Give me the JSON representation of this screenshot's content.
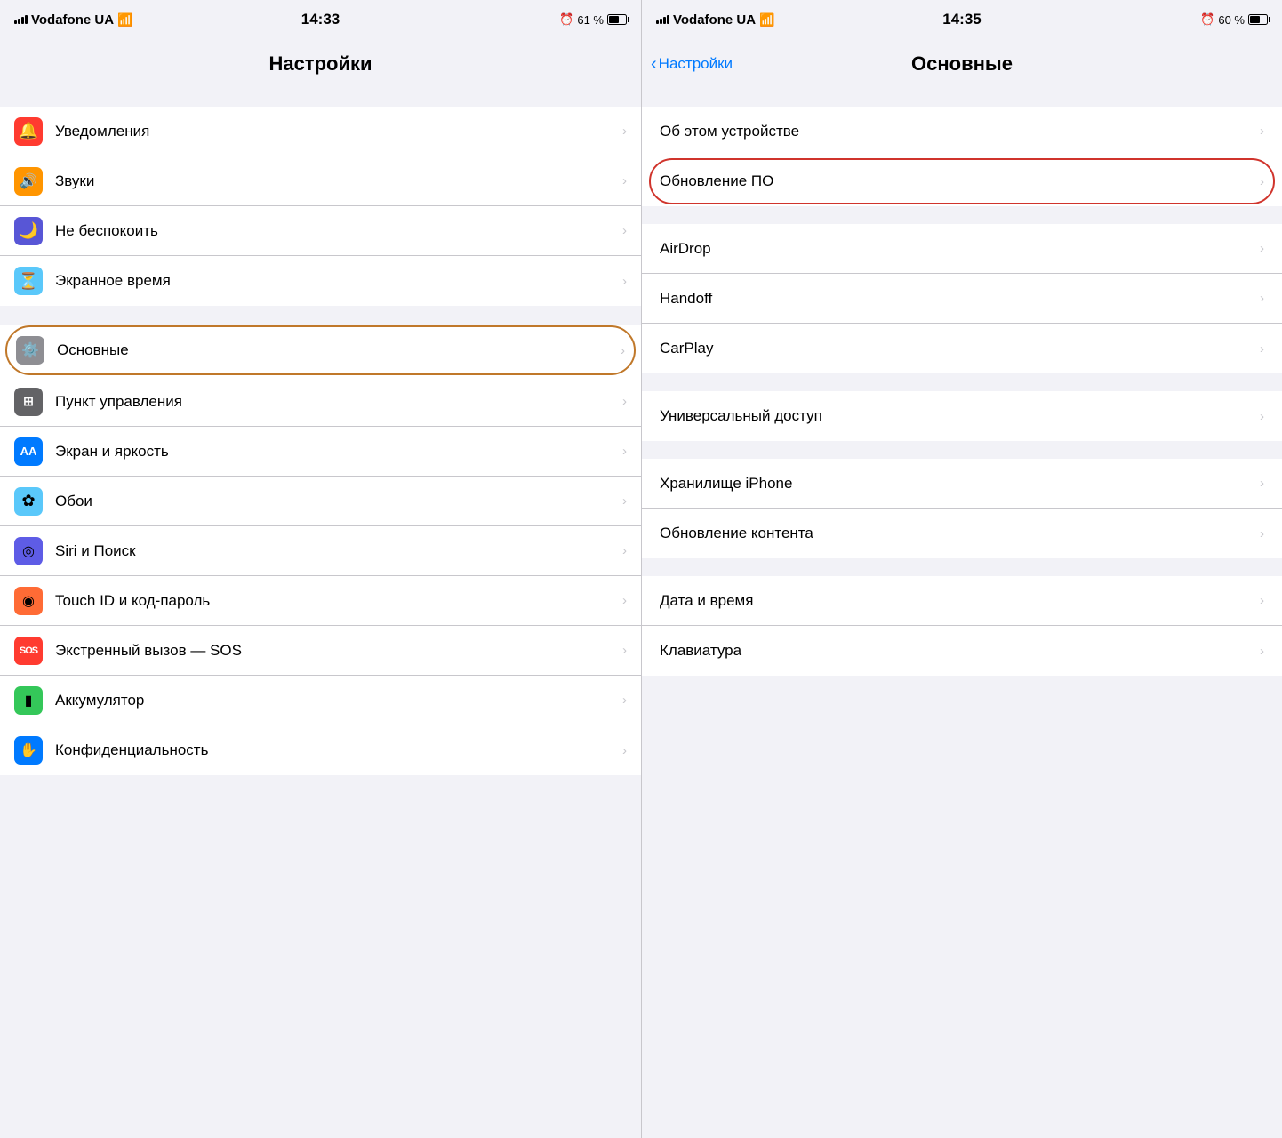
{
  "left_panel": {
    "status_bar": {
      "carrier": "Vodafone UA",
      "time": "14:33",
      "battery_percent": "61 %",
      "alarm": "⏰"
    },
    "nav": {
      "title": "Настройки"
    },
    "sections": [
      {
        "id": "notifications-group",
        "rows": [
          {
            "id": "notifications",
            "icon": "🔔",
            "icon_class": "icon-red",
            "label": "Уведомления"
          },
          {
            "id": "sounds",
            "icon": "🔊",
            "icon_class": "icon-orange",
            "label": "Звуки"
          },
          {
            "id": "do-not-disturb",
            "icon": "🌙",
            "icon_class": "icon-purple",
            "label": "Не беспокоить"
          },
          {
            "id": "screen-time",
            "icon": "⏳",
            "icon_class": "icon-indigo",
            "label": "Экранное время"
          }
        ]
      },
      {
        "id": "general-group",
        "rows": [
          {
            "id": "general",
            "icon": "⚙️",
            "icon_class": "icon-gray",
            "label": "Основные",
            "highlighted": true
          },
          {
            "id": "control-center",
            "icon": "⊞",
            "icon_class": "icon-gray2",
            "label": "Пункт управления"
          },
          {
            "id": "display",
            "icon": "AA",
            "icon_class": "icon-blue",
            "label": "Экран и яркость"
          },
          {
            "id": "wallpaper",
            "icon": "✿",
            "icon_class": "icon-blue2",
            "label": "Обои"
          },
          {
            "id": "siri",
            "icon": "◎",
            "icon_class": "icon-purple2",
            "label": "Siri и Поиск"
          },
          {
            "id": "touch-id",
            "icon": "◉",
            "icon_class": "icon-touch",
            "label": "Touch ID и код-пароль"
          },
          {
            "id": "sos",
            "icon": "SOS",
            "icon_class": "icon-sos",
            "label": "Экстренный вызов — SOS"
          },
          {
            "id": "battery",
            "icon": "▮",
            "icon_class": "icon-battery-green",
            "label": "Аккумулятор"
          },
          {
            "id": "privacy",
            "icon": "✋",
            "icon_class": "icon-privacy",
            "label": "Конфиденциальность"
          }
        ]
      }
    ]
  },
  "right_panel": {
    "status_bar": {
      "carrier": "Vodafone UA",
      "time": "14:35",
      "battery_percent": "60 %",
      "alarm": "⏰"
    },
    "nav": {
      "back_label": "Настройки",
      "title": "Основные"
    },
    "sections": [
      {
        "id": "device-group",
        "rows": [
          {
            "id": "about",
            "label": "Об этом устройстве"
          },
          {
            "id": "software-update",
            "label": "Обновление ПО",
            "highlighted": true
          }
        ]
      },
      {
        "id": "connectivity-group",
        "rows": [
          {
            "id": "airdrop",
            "label": "AirDrop"
          },
          {
            "id": "handoff",
            "label": "Handoff"
          },
          {
            "id": "carplay",
            "label": "CarPlay"
          }
        ]
      },
      {
        "id": "accessibility-group",
        "rows": [
          {
            "id": "accessibility",
            "label": "Универсальный доступ"
          }
        ]
      },
      {
        "id": "storage-group",
        "rows": [
          {
            "id": "iphone-storage",
            "label": "Хранилище iPhone"
          },
          {
            "id": "background-refresh",
            "label": "Обновление контента"
          }
        ]
      },
      {
        "id": "datetime-group",
        "rows": [
          {
            "id": "date-time",
            "label": "Дата и время"
          },
          {
            "id": "keyboard",
            "label": "Клавиатура"
          }
        ]
      }
    ]
  }
}
